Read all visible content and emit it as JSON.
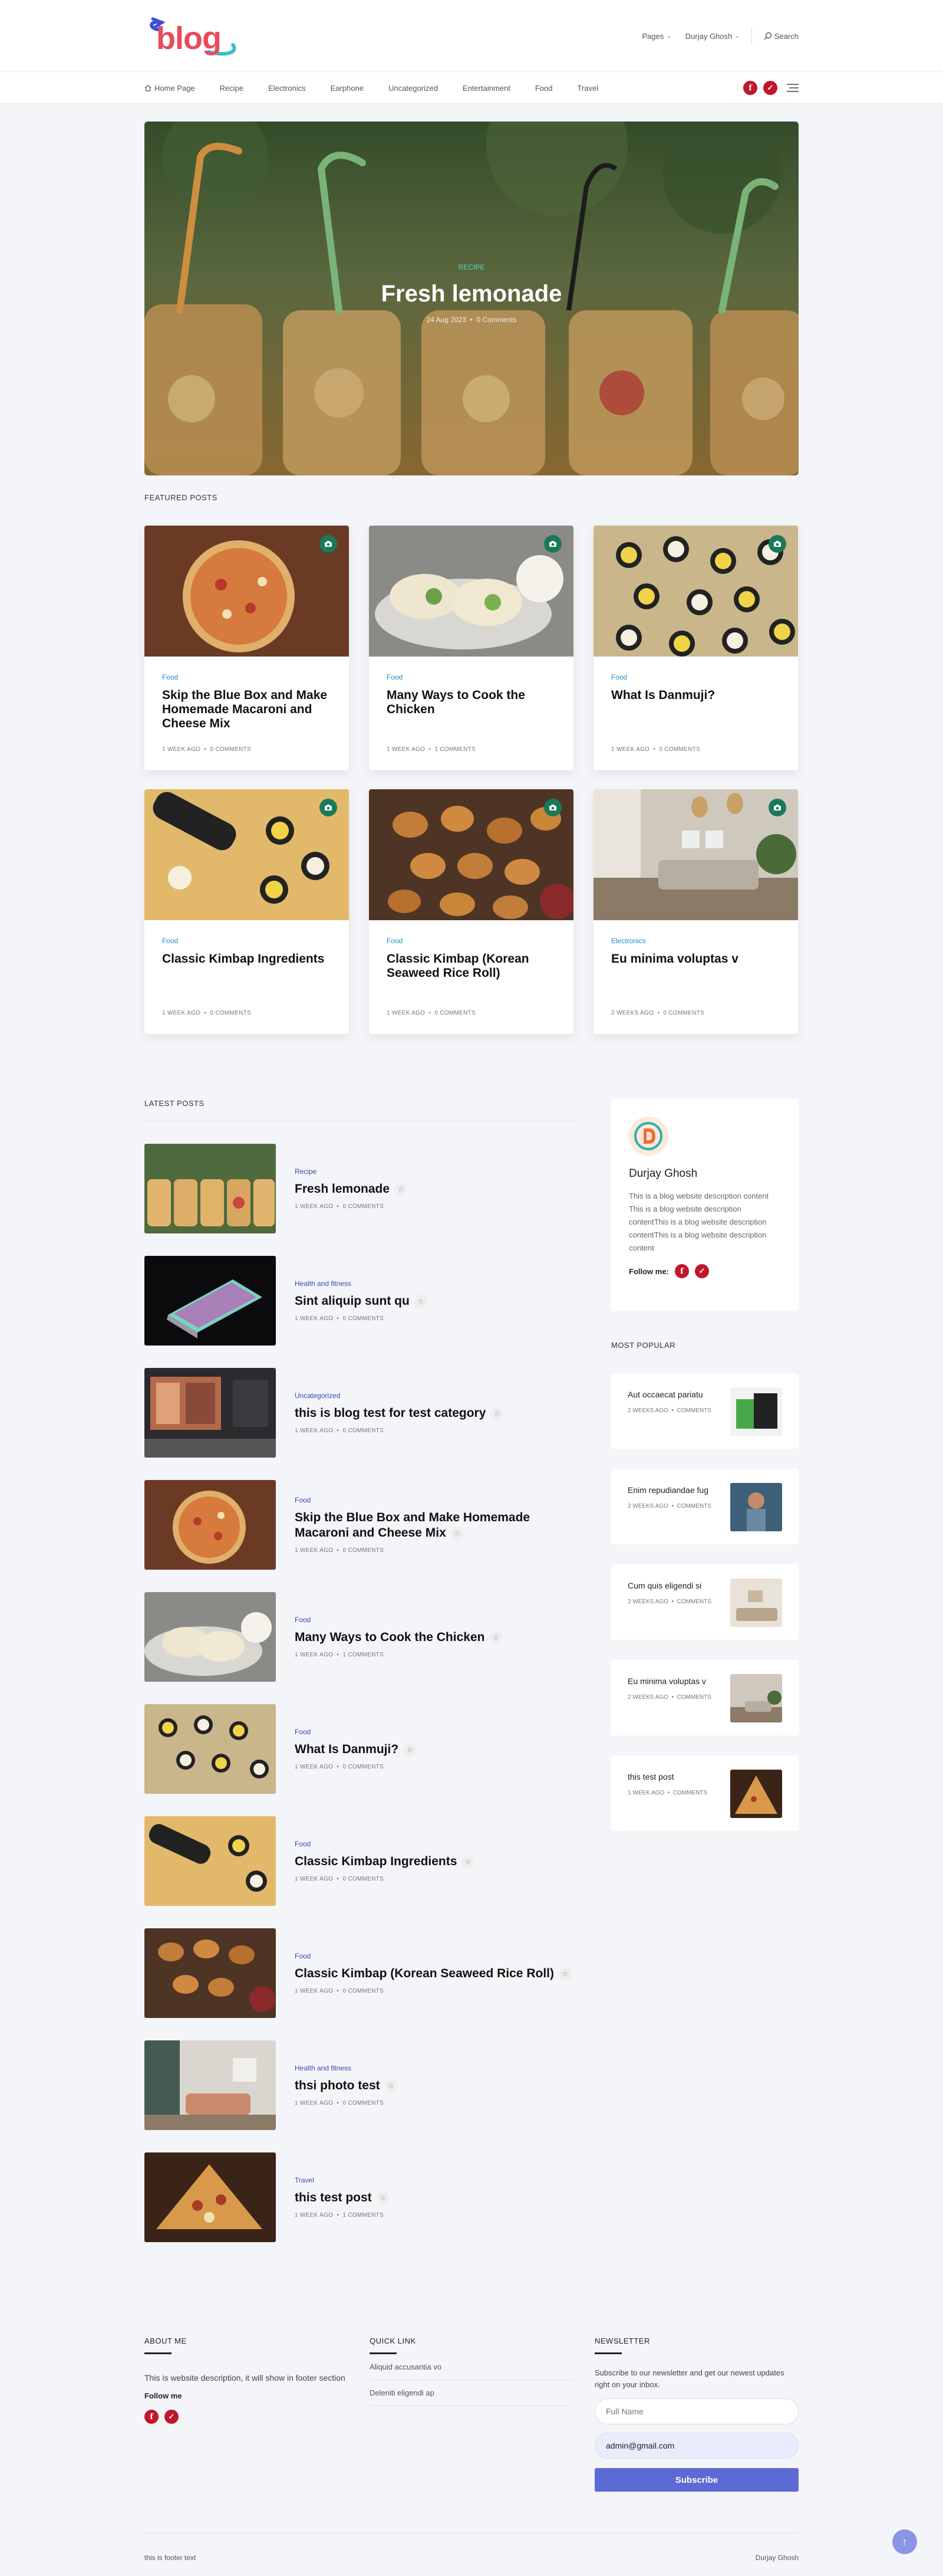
{
  "header": {
    "logo_text": "blog",
    "nav": [
      {
        "label": "Pages"
      },
      {
        "label": "Durjay Ghosh"
      }
    ],
    "search_label": "Search"
  },
  "menu": {
    "items": [
      "Home Page",
      "Recipe",
      "Electronics",
      "Earphone",
      "Uncategorized",
      "Entertainment",
      "Food",
      "Travel"
    ]
  },
  "hero": {
    "category": "RECIPE",
    "title": "Fresh lemonade",
    "date": "24 Aug 2023",
    "comments": "0 Comments"
  },
  "featured": {
    "title": "FEATURED POSTS",
    "posts": [
      {
        "category": "Food",
        "title": "Skip the Blue Box and Make Homemade Macaroni and Cheese Mix",
        "time": "1 WEEK AGO",
        "comments": "0 COMMENTS"
      },
      {
        "category": "Food",
        "title": "Many Ways to Cook the Chicken",
        "time": "1 WEEK AGO",
        "comments": "1 COMMENTS"
      },
      {
        "category": "Food",
        "title": "What Is Danmuji?",
        "time": "1 WEEK AGO",
        "comments": "0 COMMENTS"
      },
      {
        "category": "Food",
        "title": "Classic Kimbap Ingredients",
        "time": "1 WEEK AGO",
        "comments": "0 COMMENTS"
      },
      {
        "category": "Food",
        "title": "Classic Kimbap (Korean Seaweed Rice Roll)",
        "time": "1 WEEK AGO",
        "comments": "0 COMMENTS"
      },
      {
        "category": "Electronics",
        "title": "Eu minima voluptas v",
        "time": "2 WEEKS AGO",
        "comments": "0 COMMENTS"
      }
    ]
  },
  "latest": {
    "title": "LATEST POSTS",
    "posts": [
      {
        "category": "Recipe",
        "title": "Fresh lemonade",
        "time": "1 WEEK AGO",
        "comments": "0 COMMENTS"
      },
      {
        "category": "Health and fitness",
        "title": "Sint aliquip sunt qu",
        "time": "1 WEEK AGO",
        "comments": "0 COMMENTS"
      },
      {
        "category": "Uncategorized",
        "title": "this is blog test for test category",
        "time": "1 WEEK AGO",
        "comments": "0 COMMENTS"
      },
      {
        "category": "Food",
        "title": "Skip the Blue Box and Make Homemade Macaroni and Cheese Mix",
        "time": "1 WEEK AGO",
        "comments": "0 COMMENTS"
      },
      {
        "category": "Food",
        "title": "Many Ways to Cook the Chicken",
        "time": "1 WEEK AGO",
        "comments": "1 COMMENTS"
      },
      {
        "category": "Food",
        "title": "What Is Danmuji?",
        "time": "1 WEEK AGO",
        "comments": "0 COMMENTS"
      },
      {
        "category": "Food",
        "title": "Classic Kimbap Ingredients",
        "time": "1 WEEK AGO",
        "comments": "0 COMMENTS"
      },
      {
        "category": "Food",
        "title": "Classic Kimbap (Korean Seaweed Rice Roll)",
        "time": "1 WEEK AGO",
        "comments": "0 COMMENTS"
      },
      {
        "category": "Health and fitness",
        "title": "thsi photo test",
        "time": "1 WEEK AGO",
        "comments": "0 COMMENTS"
      },
      {
        "category": "Travel",
        "title": "this test post",
        "time": "1 WEEK AGO",
        "comments": "1 COMMENTS"
      }
    ]
  },
  "sidebar": {
    "author_name": "Durjay Ghosh",
    "author_desc": "This is a blog website description content This is a blog website description contentThis is a blog website description contentThis is a blog website description content",
    "follow_label": "Follow me:",
    "popular_title": "MOST POPULAR",
    "popular": [
      {
        "title": "Aut occaecat pariatu",
        "time": "2 WEEKS AGO",
        "comments": "COMMENTS"
      },
      {
        "title": "Enim repudiandae fug",
        "time": "2 WEEKS AGO",
        "comments": "COMMENTS"
      },
      {
        "title": "Cum quis eligendi si",
        "time": "2 WEEKS AGO",
        "comments": "COMMENTS"
      },
      {
        "title": "Eu minima voluptas v",
        "time": "2 WEEKS AGO",
        "comments": "COMMENTS"
      },
      {
        "title": "this test post",
        "time": "1 WEEK AGO",
        "comments": "COMMENTS"
      }
    ]
  },
  "footer": {
    "about_title": "ABOUT ME",
    "about_text": "This is website description, it will show in footer section",
    "follow_label": "Follow me",
    "quick_title": "QUICK LINK",
    "quick_links": [
      "Aliquid accusantia vo",
      "Deleniti eligendi ap"
    ],
    "newsletter_title": "NEWSLETTER",
    "newsletter_text": "Subscribe to our newsletter and get our newest updates right on your inbox.",
    "name_placeholder": "Full Name",
    "email_value": "admin@gmail.com",
    "subscribe_label": "Subscribe",
    "copy_left": "this is footer text",
    "copy_right": "Durjay Ghosh"
  },
  "colors": {
    "accent": "#5c6bd3",
    "brand": "#e84a5f",
    "social": "#c0172a",
    "badge": "#197a5a"
  }
}
